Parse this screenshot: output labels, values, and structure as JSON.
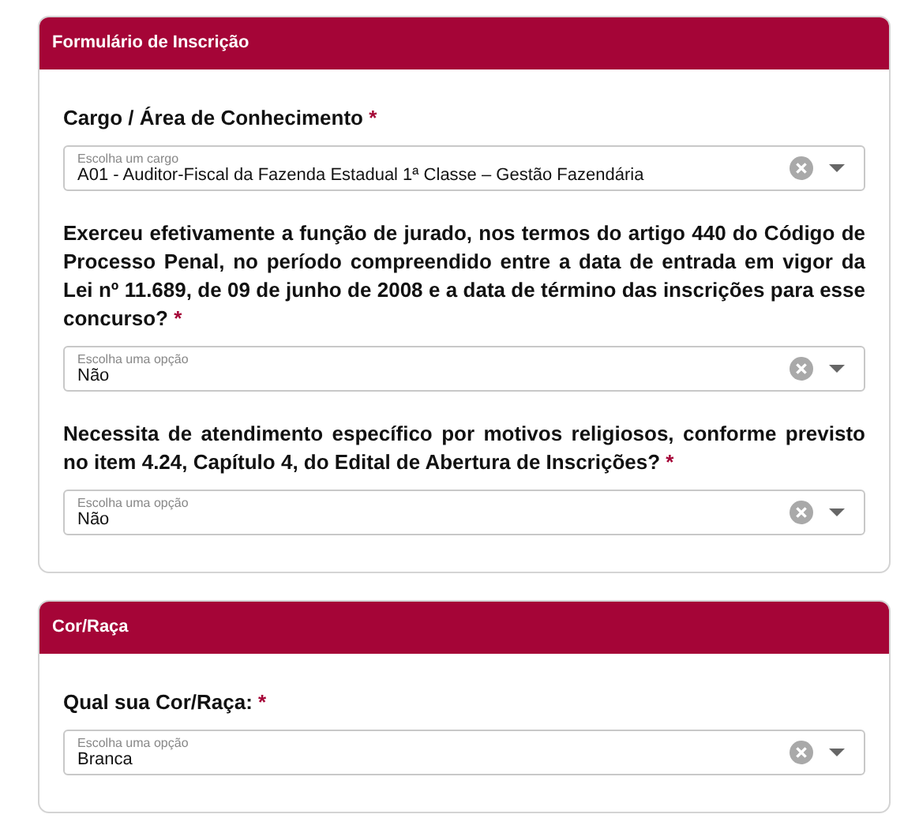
{
  "sections": [
    {
      "title": "Formulário de Inscrição",
      "fields": [
        {
          "label": "Cargo / Área de Conhecimento",
          "required_mark": "*",
          "placeholder": "Escolha um cargo",
          "value": "A01 - Auditor-Fiscal da Fazenda Estadual 1ª Classe – Gestão Fazendária"
        },
        {
          "label": "Exerceu efetivamente a função de jurado, nos termos do artigo 440 do Código de Processo Penal, no período compreendido entre a data de entrada em vigor da Lei nº 11.689, de 09 de junho de 2008 e a data de término das inscrições para esse concurso?",
          "required_mark": "*",
          "placeholder": "Escolha uma opção",
          "value": "Não"
        },
        {
          "label": "Necessita de atendimento específico por motivos religiosos, conforme previsto no item 4.24, Capítulo 4, do Edital de Abertura de Inscrições?",
          "required_mark": "*",
          "placeholder": "Escolha uma opção",
          "value": "Não"
        }
      ]
    },
    {
      "title": "Cor/Raça",
      "fields": [
        {
          "label": "Qual sua Cor/Raça:",
          "required_mark": "*",
          "placeholder": "Escolha uma opção",
          "value": "Branca"
        }
      ]
    }
  ]
}
